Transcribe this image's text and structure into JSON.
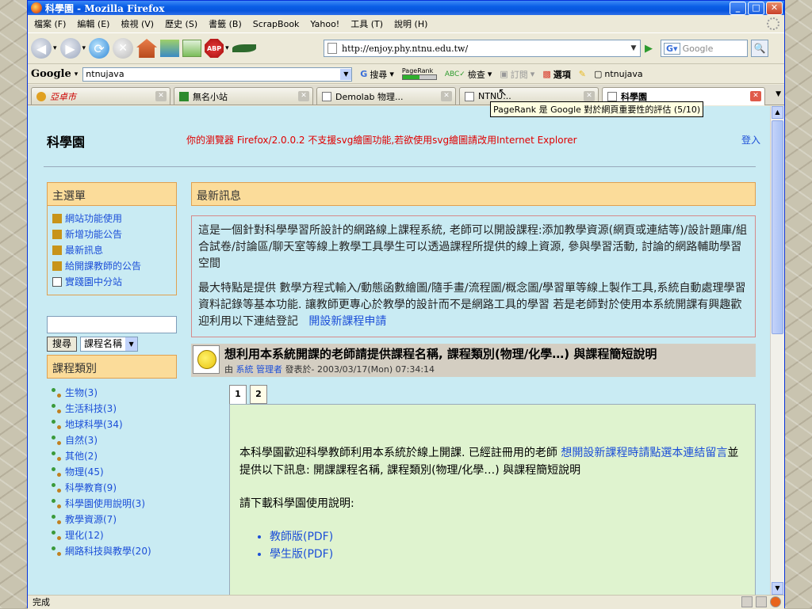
{
  "window": {
    "title": "科學園 - Mozilla Firefox"
  },
  "menubar": [
    "檔案 (F)",
    "編輯 (E)",
    "檢視 (V)",
    "歷史 (S)",
    "書籤 (B)",
    "ScrapBook",
    "Yahoo!",
    "工具 (T)",
    "說明 (H)"
  ],
  "navbar": {
    "url": "http://enjoy.phy.ntnu.edu.tw/",
    "search_placeholder": "Google",
    "abp_label": "ABP"
  },
  "gbar": {
    "logo": "Google",
    "query": "ntnujava",
    "search": "搜尋",
    "pagerank": "PageRank",
    "spell": "檢查",
    "subscribe": "訂閱",
    "options": "選項",
    "user": "ntnujava"
  },
  "tabs": [
    {
      "label": "亞卓市",
      "active": false
    },
    {
      "label": "無名小站",
      "active": false
    },
    {
      "label": "Demolab 物理...",
      "active": false
    },
    {
      "label": "NTNU...",
      "active": false
    },
    {
      "label": "科學園",
      "active": true
    }
  ],
  "tooltip": "PageRank 是 Google 對於網頁重要性的評估 (5/10)",
  "site": {
    "title": "科學園",
    "svg_warning": "你的瀏覽器 Firefox/2.0.0.2 不支援svg繪圖功能,若欲使用svg繪圖請改用Internet Explorer",
    "login": "登入"
  },
  "sidebar": {
    "menu_title": "主選單",
    "menu": [
      "網站功能使用",
      "新增功能公告",
      "最新訊息",
      "給開課教師的公告",
      "實踐園中分站"
    ],
    "search_button": "搜尋",
    "search_scope": "課程名稱",
    "category_title": "課程類別",
    "categories": [
      "生物(3)",
      "生活科技(3)",
      "地球科學(34)",
      "自然(3)",
      "其他(2)",
      "物理(45)",
      "科學教育(9)",
      "科學園使用說明(3)",
      "教學資源(7)",
      "理化(12)",
      "網路科技與教學(20)"
    ]
  },
  "main": {
    "news_title": "最新訊息",
    "intro_p1": "這是一個針對科學學習所設計的網路線上課程系統, 老師可以開設課程:添加教學資源(網頁或連結等)/設計題庫/組合試卷/討論區/聊天室等線上教學工具學生可以透過課程所提供的線上資源, 參與學習活動, 討論的網路輔助學習空間",
    "intro_p2": "最大特點是提供 數學方程式輸入/動態函數繪圖/隨手畫/流程圖/概念圖/學習單等線上製作工具,系統自動處理學習資料記錄等基本功能. 讓教師更專心於教學的設計而不是網路工具的學習 若是老師對於使用本系統開課有興趣歡迎利用以下連結登記",
    "intro_link": "開設新課程申請",
    "post_title": "想利用本系統開課的老師請提供課程名稱, 課程類別(物理/化學…) 與課程簡短說明",
    "post_meta_prefix": "由",
    "post_author": "系統 管理者",
    "post_meta_suffix": "發表於- 2003/03/17(Mon) 07:34:14",
    "post_tabs": [
      "1",
      "2"
    ],
    "body_p1_a": "本科學園歡迎科學教師利用本系統於線上開課. 已經註冊用的老師",
    "body_p1_link": "想開設新課程時請點選本連結留言",
    "body_p1_b": "並提供以下訊息: 開課課程名稱, 課程類別(物理/化學…) 與課程簡短說明",
    "body_p2": "請下載科學園使用說明:",
    "downloads": [
      "教師版(PDF)",
      "學生版(PDF)"
    ]
  },
  "status": "完成"
}
